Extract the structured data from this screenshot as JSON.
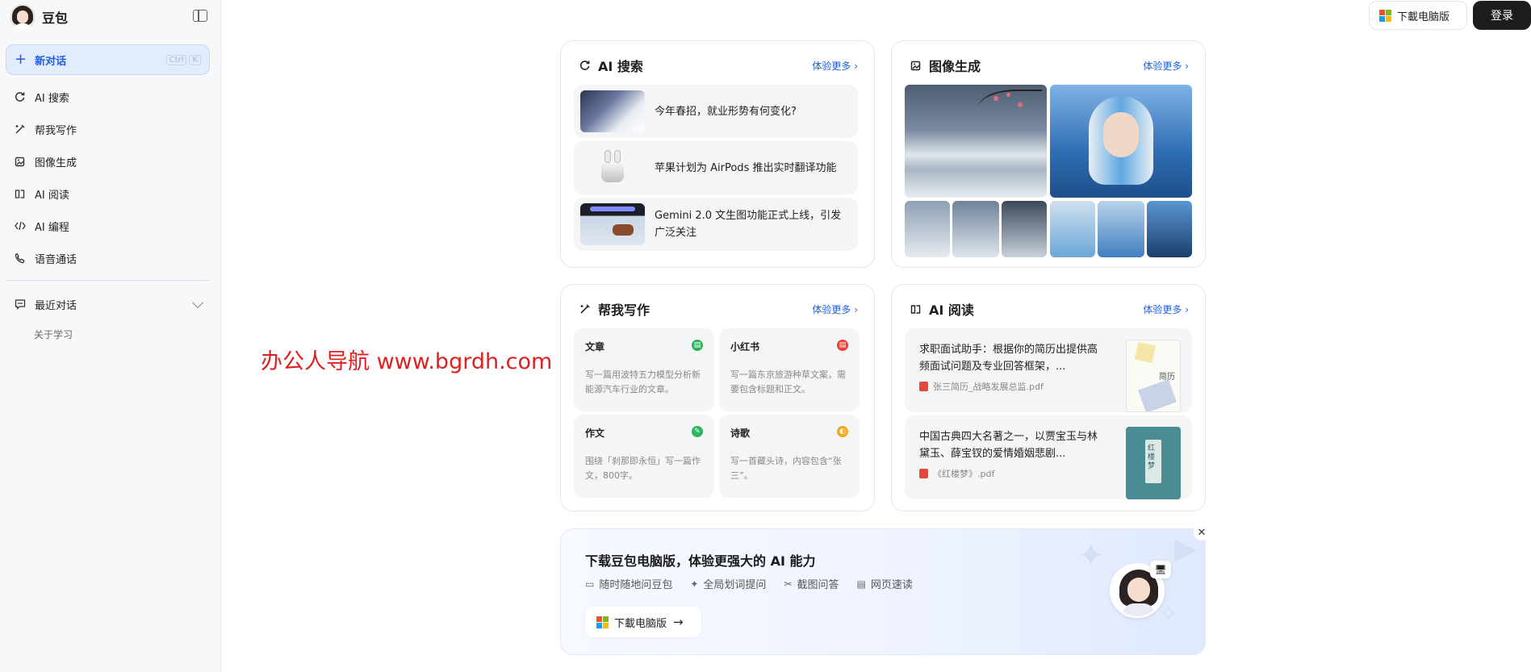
{
  "brand": {
    "name": "豆包"
  },
  "sidebar": {
    "new_chat": {
      "label": "新对话",
      "kbd": [
        "Ctrl",
        "K"
      ]
    },
    "items": [
      {
        "label": "AI 搜索",
        "icon": "ai-search-icon"
      },
      {
        "label": "帮我写作",
        "icon": "write-icon"
      },
      {
        "label": "图像生成",
        "icon": "image-icon"
      },
      {
        "label": "AI 阅读",
        "icon": "read-icon"
      },
      {
        "label": "AI 编程",
        "icon": "code-icon"
      },
      {
        "label": "语音通话",
        "icon": "phone-icon"
      }
    ],
    "recent": {
      "label": "最近对话",
      "items": [
        "关于学习"
      ]
    }
  },
  "top": {
    "download_label": "下載电脑版",
    "login_label": "登录"
  },
  "common": {
    "more_label": "体验更多"
  },
  "search_card": {
    "title": "AI 搜索",
    "rows": [
      {
        "text": "今年春招，就业形势有何变化?"
      },
      {
        "text": "苹果计划为 AirPods 推出实时翻译功能"
      },
      {
        "text": "Gemini 2.0 文生图功能正式上线，引发广泛关注"
      }
    ]
  },
  "image_card": {
    "title": "图像生成"
  },
  "write_card": {
    "title": "帮我写作",
    "cells": [
      {
        "title": "文章",
        "desc": "写一篇用波特五力模型分析新能源汽车行业的文章。",
        "color": "#2cb55e",
        "glyph": "▤"
      },
      {
        "title": "小红书",
        "desc": "写一篇东京旅游种草文案，需要包含标题和正文。",
        "color": "#e8413b",
        "glyph": "▤"
      },
      {
        "title": "作文",
        "desc": "围绕「刹那即永恒」写一篇作文，800字。",
        "color": "#2cb55e",
        "glyph": "✎"
      },
      {
        "title": "诗歌",
        "desc": "写一首藏头诗，内容包含“张三”。",
        "color": "#f5a623",
        "glyph": "◐"
      }
    ]
  },
  "read_card": {
    "title": "AI 阅读",
    "rows": [
      {
        "text": "求职面试助手：根据你的简历出提供高频面试问题及专业回答框架，...",
        "file": "张三简历_战略发展总监.pdf",
        "cover_text": "简历"
      },
      {
        "text": "中国古典四大名著之一，以贾宝玉与林黛玉、薛宝钗的爱情婚姻悲剧...",
        "file": "《红楼梦》.pdf",
        "cover_text": "红楼梦"
      }
    ]
  },
  "banner": {
    "title": "下载豆包电脑版，体验更强大的 AI 能力",
    "features": [
      {
        "label": "随时随地问豆包",
        "icon": "chat-icon"
      },
      {
        "label": "全局划词提问",
        "icon": "sparkle-icon"
      },
      {
        "label": "截图问答",
        "icon": "scissors-icon"
      },
      {
        "label": "网页速读",
        "icon": "doc-icon"
      }
    ],
    "button_label": "下載电脑版"
  },
  "watermark": "办公人导航 www.bgrdh.com",
  "colors": {
    "accent": "#1f5ee0",
    "dark": "#1d1d1f"
  }
}
